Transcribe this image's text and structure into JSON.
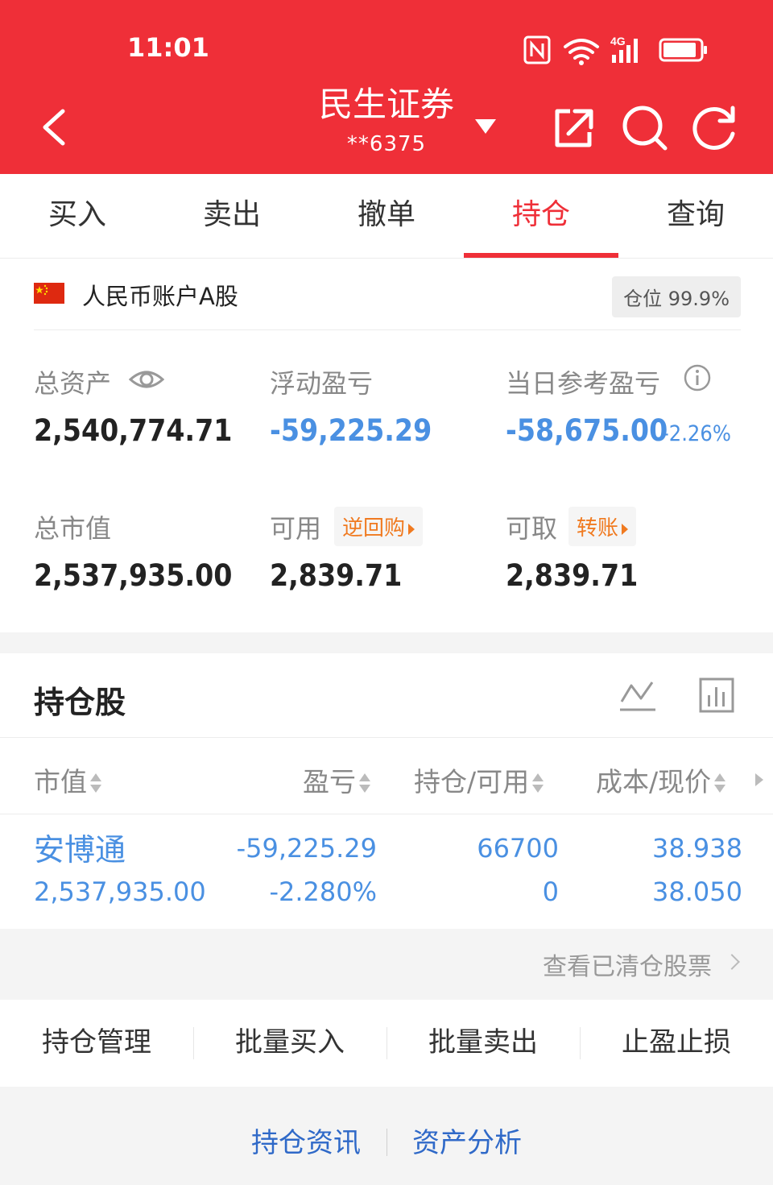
{
  "status_bar": {
    "time": "11:01",
    "network": "4G"
  },
  "header": {
    "title": "民生证券",
    "account": "**6375"
  },
  "tabs": [
    {
      "label": "买入"
    },
    {
      "label": "卖出"
    },
    {
      "label": "撤单"
    },
    {
      "label": "持仓",
      "active": true
    },
    {
      "label": "查询"
    }
  ],
  "account_info": {
    "name": "人民币账户A股",
    "position_label": "仓位 99.9%"
  },
  "summary": {
    "total_assets": {
      "label": "总资产",
      "value": "2,540,774.71"
    },
    "floating_pl": {
      "label": "浮动盈亏",
      "value": "-59,225.29"
    },
    "daily_pl": {
      "label": "当日参考盈亏",
      "value": "-58,675.00",
      "pct": "-2.26%"
    },
    "market_value": {
      "label": "总市值",
      "value": "2,537,935.00"
    },
    "available": {
      "label": "可用",
      "tag": "逆回购",
      "value": "2,839.71"
    },
    "withdrawable": {
      "label": "可取",
      "tag": "转账",
      "value": "2,839.71"
    }
  },
  "holdings": {
    "title": "持仓股",
    "columns": [
      "市值",
      "盈亏",
      "持仓/可用",
      "成本/现价"
    ],
    "rows": [
      {
        "name": "安博通",
        "market_value": "2,537,935.00",
        "pl": "-59,225.29",
        "pl_pct": "-2.280%",
        "position": "66700",
        "available": "0",
        "cost": "38.938",
        "price": "38.050"
      }
    ],
    "cleared_link": "查看已清仓股票"
  },
  "actions": [
    "持仓管理",
    "批量买入",
    "批量卖出",
    "止盈止损"
  ],
  "links": [
    "持仓资讯",
    "资产分析"
  ],
  "colors": {
    "brand_red": "#ef2f38",
    "loss_blue": "#4a90e2",
    "tag_orange": "#f07a20",
    "link_blue": "#2f69c8"
  }
}
